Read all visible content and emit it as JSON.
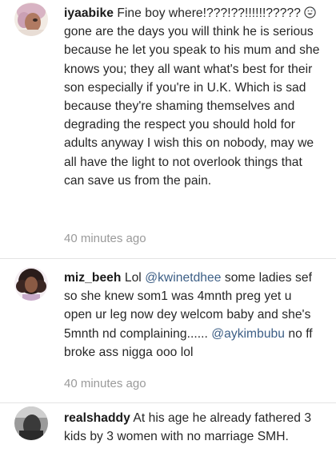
{
  "comments": [
    {
      "username": "iyaabike",
      "avatar_icon": "avatar-photo-pink-hair",
      "text_before_emoji": "Fine boy where!???!??!!!!!!????? ",
      "emoji_icon": "grinning-sweat-face-icon",
      "text_after_emoji": " gone are the days you will think he is serious because he let you speak to his mum and she knows you; they all want what's best for their son especially if you're in U.K. Which is sad because they're shaming themselves and degrading the respect you should hold for adults anyway I wish this on nobody, may we all have the light to not overlook things that can save us from the pain.",
      "timestamp": "40 minutes ago"
    },
    {
      "username": "miz_beeh",
      "avatar_icon": "avatar-photo-curly-hair",
      "text_1": "Lol ",
      "mention_1": "@kwinetdhee",
      "text_2": " some ladies sef so she knew som1 was 4mnth preg yet u open ur leg now dey welcom baby and she's 5mnth nd complaining...... ",
      "mention_2": "@aykimbubu",
      "text_3": " no ff broke ass nigga ooo lol",
      "timestamp": "40 minutes ago"
    },
    {
      "username": "realshaddy",
      "avatar_icon": "avatar-photo-dark",
      "text": "At his age he already fathered 3 kids by 3 women with no marriage SMH."
    }
  ],
  "colors": {
    "mention": "#3c5e85",
    "timestamp": "#9a9a9a",
    "text": "#262626"
  }
}
